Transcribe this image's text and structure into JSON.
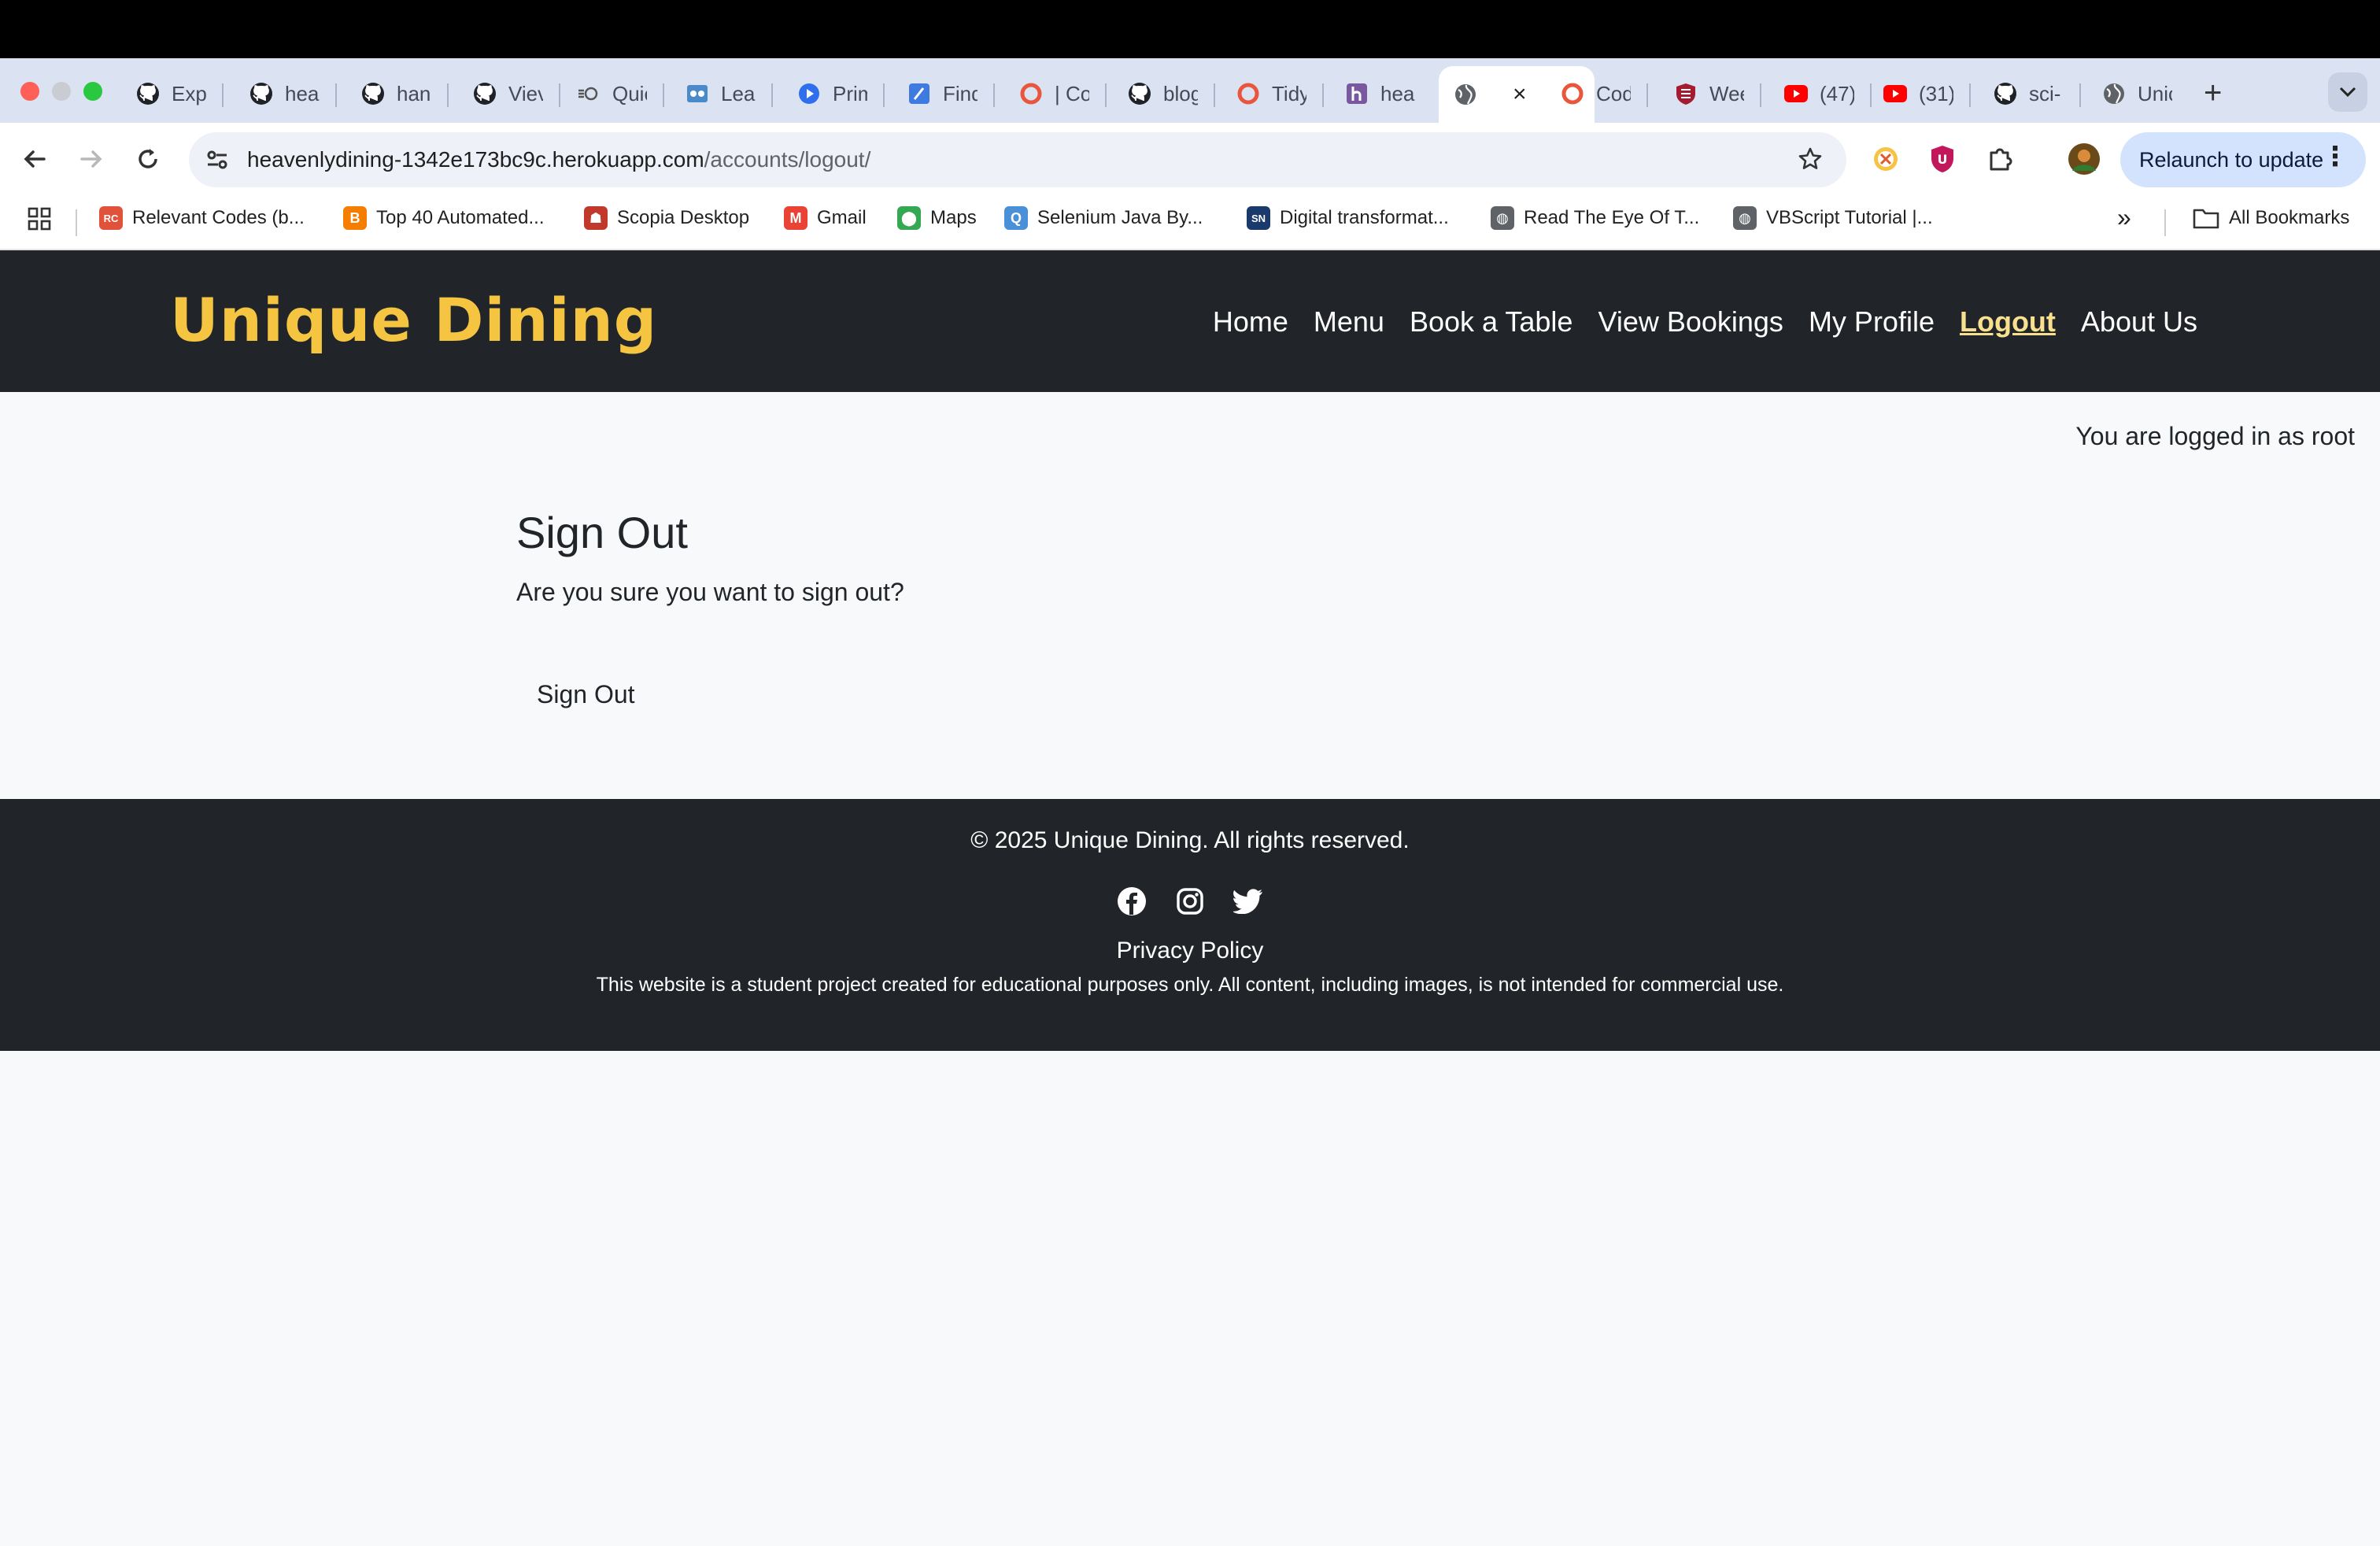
{
  "browser": {
    "tabs": [
      {
        "title": "Exp",
        "icon": "github-icon"
      },
      {
        "title": "hea",
        "icon": "github-icon"
      },
      {
        "title": "han",
        "icon": "github-icon"
      },
      {
        "title": "Viev",
        "icon": "github-icon"
      },
      {
        "title": "Quic",
        "icon": "quick-icon"
      },
      {
        "title": "Lear",
        "icon": "learn-icon"
      },
      {
        "title": "Prim",
        "icon": "play-icon"
      },
      {
        "title": "Find",
        "icon": "find-icon"
      },
      {
        "title": "| Co",
        "icon": "circle-icon"
      },
      {
        "title": "blog",
        "icon": "github-icon"
      },
      {
        "title": "Tidy",
        "icon": "circle-icon"
      },
      {
        "title": "hea",
        "icon": "heroku-icon"
      },
      {
        "title": "",
        "icon": "globe-icon",
        "active": true
      },
      {
        "title": "Cod",
        "icon": "circle-icon"
      },
      {
        "title": "Wee",
        "icon": "shield-icon"
      },
      {
        "title": "(47)",
        "icon": "youtube-icon"
      },
      {
        "title": "(31)",
        "icon": "youtube-icon"
      },
      {
        "title": "sci-",
        "icon": "github-icon"
      },
      {
        "title": "Unic",
        "icon": "globe-icon"
      }
    ],
    "close_tab_label": "×",
    "new_tab_label": "+",
    "tab_menu_label": "⌄",
    "url_host": "heavenlydining-1342e173bc9c.herokuapp.com",
    "url_path": "/accounts/logout/",
    "relaunch_label": "Relaunch to update",
    "relaunch_dots": "⋮",
    "bookmarks": [
      {
        "label": "Relevant Codes (b...",
        "icon": "rc-icon",
        "color": "#e0533a"
      },
      {
        "label": "Top 40 Automated...",
        "icon": "blogger-icon",
        "color": "#f57d00"
      },
      {
        "label": "Scopia Desktop",
        "icon": "robot-icon",
        "color": "#c0392b"
      },
      {
        "label": "Gmail",
        "icon": "gmail-icon",
        "color": "#ea4335"
      },
      {
        "label": "Maps",
        "icon": "maps-icon",
        "color": "#34a853"
      },
      {
        "label": "Selenium Java By...",
        "icon": "q-icon",
        "color": "#4a90d9"
      },
      {
        "label": "Digital transformat...",
        "icon": "sn-icon",
        "color": "#1a3a6b"
      },
      {
        "label": "Read The Eye Of T...",
        "icon": "globe-icon",
        "color": "#5f6368"
      },
      {
        "label": "VBScript Tutorial |...",
        "icon": "globe-icon",
        "color": "#5f6368"
      }
    ],
    "bookmarks_more": "»",
    "all_bookmarks": "All Bookmarks"
  },
  "site": {
    "brand": "Unique Dining",
    "nav": [
      {
        "label": "Home"
      },
      {
        "label": "Menu"
      },
      {
        "label": "Book a Table"
      },
      {
        "label": "View Bookings"
      },
      {
        "label": "My Profile"
      },
      {
        "label": "Logout",
        "active": true
      },
      {
        "label": "About Us"
      }
    ],
    "logged_in_text": "You are logged in as root",
    "title": "Sign Out",
    "question": "Are you sure you want to sign out?",
    "signout_button": "Sign Out",
    "footer": {
      "copyright": "© 2025 Unique Dining. All rights reserved.",
      "social": [
        "facebook-icon",
        "instagram-icon",
        "twitter-icon"
      ],
      "privacy": "Privacy Policy",
      "disclaimer": "This website is a student project created for educational purposes only. All content, including images, is not intended for commercial use."
    }
  },
  "colors": {
    "brand": "#f5c542",
    "header_bg": "#212529",
    "page_bg": "#f8f9fa",
    "active_nav": "#f8e08e"
  }
}
